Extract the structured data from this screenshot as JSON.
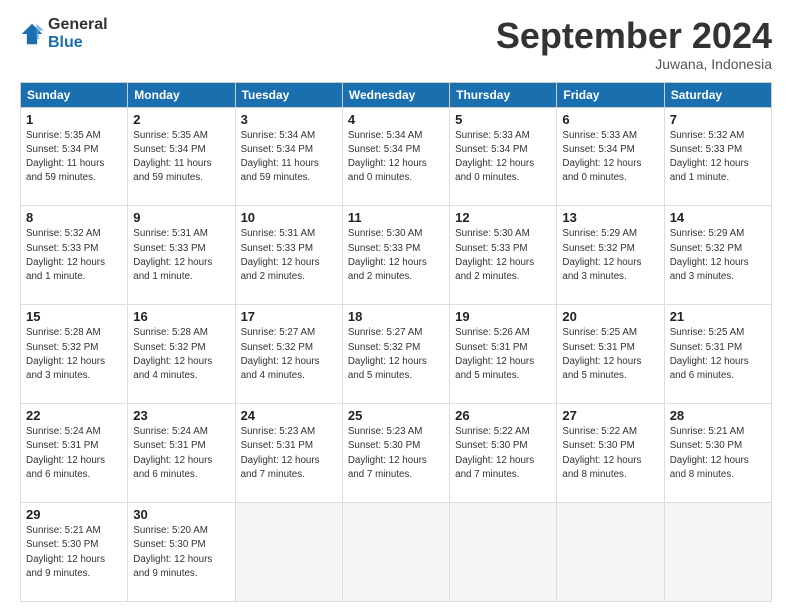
{
  "logo": {
    "line1": "General",
    "line2": "Blue"
  },
  "title": "September 2024",
  "subtitle": "Juwana, Indonesia",
  "days_header": [
    "Sunday",
    "Monday",
    "Tuesday",
    "Wednesday",
    "Thursday",
    "Friday",
    "Saturday"
  ],
  "weeks": [
    [
      {
        "day": "1",
        "info": "Sunrise: 5:35 AM\nSunset: 5:34 PM\nDaylight: 11 hours\nand 59 minutes."
      },
      {
        "day": "2",
        "info": "Sunrise: 5:35 AM\nSunset: 5:34 PM\nDaylight: 11 hours\nand 59 minutes."
      },
      {
        "day": "3",
        "info": "Sunrise: 5:34 AM\nSunset: 5:34 PM\nDaylight: 11 hours\nand 59 minutes."
      },
      {
        "day": "4",
        "info": "Sunrise: 5:34 AM\nSunset: 5:34 PM\nDaylight: 12 hours\nand 0 minutes."
      },
      {
        "day": "5",
        "info": "Sunrise: 5:33 AM\nSunset: 5:34 PM\nDaylight: 12 hours\nand 0 minutes."
      },
      {
        "day": "6",
        "info": "Sunrise: 5:33 AM\nSunset: 5:34 PM\nDaylight: 12 hours\nand 0 minutes."
      },
      {
        "day": "7",
        "info": "Sunrise: 5:32 AM\nSunset: 5:33 PM\nDaylight: 12 hours\nand 1 minute."
      }
    ],
    [
      {
        "day": "8",
        "info": "Sunrise: 5:32 AM\nSunset: 5:33 PM\nDaylight: 12 hours\nand 1 minute."
      },
      {
        "day": "9",
        "info": "Sunrise: 5:31 AM\nSunset: 5:33 PM\nDaylight: 12 hours\nand 1 minute."
      },
      {
        "day": "10",
        "info": "Sunrise: 5:31 AM\nSunset: 5:33 PM\nDaylight: 12 hours\nand 2 minutes."
      },
      {
        "day": "11",
        "info": "Sunrise: 5:30 AM\nSunset: 5:33 PM\nDaylight: 12 hours\nand 2 minutes."
      },
      {
        "day": "12",
        "info": "Sunrise: 5:30 AM\nSunset: 5:33 PM\nDaylight: 12 hours\nand 2 minutes."
      },
      {
        "day": "13",
        "info": "Sunrise: 5:29 AM\nSunset: 5:32 PM\nDaylight: 12 hours\nand 3 minutes."
      },
      {
        "day": "14",
        "info": "Sunrise: 5:29 AM\nSunset: 5:32 PM\nDaylight: 12 hours\nand 3 minutes."
      }
    ],
    [
      {
        "day": "15",
        "info": "Sunrise: 5:28 AM\nSunset: 5:32 PM\nDaylight: 12 hours\nand 3 minutes."
      },
      {
        "day": "16",
        "info": "Sunrise: 5:28 AM\nSunset: 5:32 PM\nDaylight: 12 hours\nand 4 minutes."
      },
      {
        "day": "17",
        "info": "Sunrise: 5:27 AM\nSunset: 5:32 PM\nDaylight: 12 hours\nand 4 minutes."
      },
      {
        "day": "18",
        "info": "Sunrise: 5:27 AM\nSunset: 5:32 PM\nDaylight: 12 hours\nand 5 minutes."
      },
      {
        "day": "19",
        "info": "Sunrise: 5:26 AM\nSunset: 5:31 PM\nDaylight: 12 hours\nand 5 minutes."
      },
      {
        "day": "20",
        "info": "Sunrise: 5:25 AM\nSunset: 5:31 PM\nDaylight: 12 hours\nand 5 minutes."
      },
      {
        "day": "21",
        "info": "Sunrise: 5:25 AM\nSunset: 5:31 PM\nDaylight: 12 hours\nand 6 minutes."
      }
    ],
    [
      {
        "day": "22",
        "info": "Sunrise: 5:24 AM\nSunset: 5:31 PM\nDaylight: 12 hours\nand 6 minutes."
      },
      {
        "day": "23",
        "info": "Sunrise: 5:24 AM\nSunset: 5:31 PM\nDaylight: 12 hours\nand 6 minutes."
      },
      {
        "day": "24",
        "info": "Sunrise: 5:23 AM\nSunset: 5:31 PM\nDaylight: 12 hours\nand 7 minutes."
      },
      {
        "day": "25",
        "info": "Sunrise: 5:23 AM\nSunset: 5:30 PM\nDaylight: 12 hours\nand 7 minutes."
      },
      {
        "day": "26",
        "info": "Sunrise: 5:22 AM\nSunset: 5:30 PM\nDaylight: 12 hours\nand 7 minutes."
      },
      {
        "day": "27",
        "info": "Sunrise: 5:22 AM\nSunset: 5:30 PM\nDaylight: 12 hours\nand 8 minutes."
      },
      {
        "day": "28",
        "info": "Sunrise: 5:21 AM\nSunset: 5:30 PM\nDaylight: 12 hours\nand 8 minutes."
      }
    ],
    [
      {
        "day": "29",
        "info": "Sunrise: 5:21 AM\nSunset: 5:30 PM\nDaylight: 12 hours\nand 9 minutes."
      },
      {
        "day": "30",
        "info": "Sunrise: 5:20 AM\nSunset: 5:30 PM\nDaylight: 12 hours\nand 9 minutes."
      },
      {
        "day": "",
        "info": ""
      },
      {
        "day": "",
        "info": ""
      },
      {
        "day": "",
        "info": ""
      },
      {
        "day": "",
        "info": ""
      },
      {
        "day": "",
        "info": ""
      }
    ]
  ]
}
